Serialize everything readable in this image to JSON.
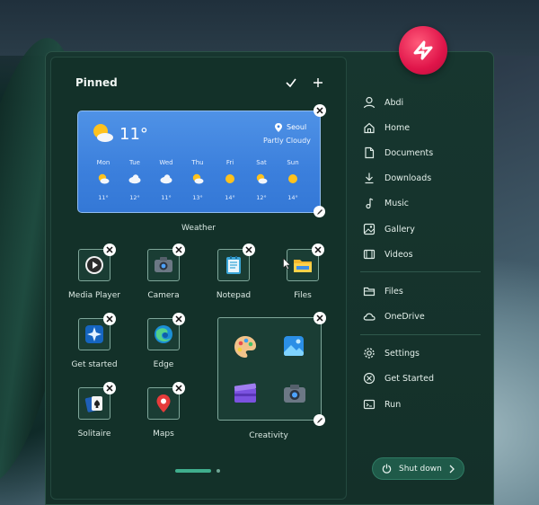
{
  "pinned": {
    "title": "Pinned",
    "check_icon": "check-icon",
    "add_icon": "plus-icon"
  },
  "weather": {
    "label": "Weather",
    "temp": "11°",
    "location": "Seoul",
    "condition": "Partly Cloudy",
    "days": [
      {
        "day": "Mon",
        "icon": "partly-sunny",
        "temp": "11°"
      },
      {
        "day": "Tue",
        "icon": "cloudy",
        "temp": "12°"
      },
      {
        "day": "Wed",
        "icon": "cloudy",
        "temp": "11°"
      },
      {
        "day": "Thu",
        "icon": "partly-sunny",
        "temp": "13°"
      },
      {
        "day": "Fri",
        "icon": "sunny",
        "temp": "14°"
      },
      {
        "day": "Sat",
        "icon": "partly-sunny",
        "temp": "12°"
      },
      {
        "day": "Sun",
        "icon": "sunny",
        "temp": "14°"
      }
    ]
  },
  "apps": [
    {
      "label": "Media Player",
      "icon": "media-player-icon"
    },
    {
      "label": "Camera",
      "icon": "camera-icon"
    },
    {
      "label": "Notepad",
      "icon": "notepad-icon"
    },
    {
      "label": "Files",
      "icon": "folder-icon"
    },
    {
      "label": "Get started",
      "icon": "get-started-icon"
    },
    {
      "label": "Edge",
      "icon": "edge-icon"
    },
    {
      "label": "Solitaire",
      "icon": "solitaire-icon"
    },
    {
      "label": "Maps",
      "icon": "maps-icon"
    }
  ],
  "creativity": {
    "label": "Creativity",
    "icons": [
      "paint-icon",
      "photos-icon",
      "clipchamp-icon",
      "camera-icon"
    ]
  },
  "sidebar": {
    "items": [
      {
        "label": "Abdi",
        "icon": "user-icon"
      },
      {
        "label": "Home",
        "icon": "home-icon"
      },
      {
        "label": "Documents",
        "icon": "document-icon"
      },
      {
        "label": "Downloads",
        "icon": "download-icon"
      },
      {
        "label": "Music",
        "icon": "music-icon"
      },
      {
        "label": "Gallery",
        "icon": "image-icon"
      },
      {
        "label": "Videos",
        "icon": "video-icon"
      },
      {
        "label": "Files",
        "icon": "files-icon"
      },
      {
        "label": "OneDrive",
        "icon": "cloud-icon"
      },
      {
        "label": "Settings",
        "icon": "gear-icon"
      },
      {
        "label": "Get Started",
        "icon": "get-started-icon"
      },
      {
        "label": "Run",
        "icon": "run-icon"
      }
    ]
  },
  "shutdown": {
    "label": "Shut down"
  },
  "colors": {
    "accent": "#3fae8d",
    "panel": "#133129",
    "weather": "#3b7fdc",
    "logo": "#e0154a"
  }
}
